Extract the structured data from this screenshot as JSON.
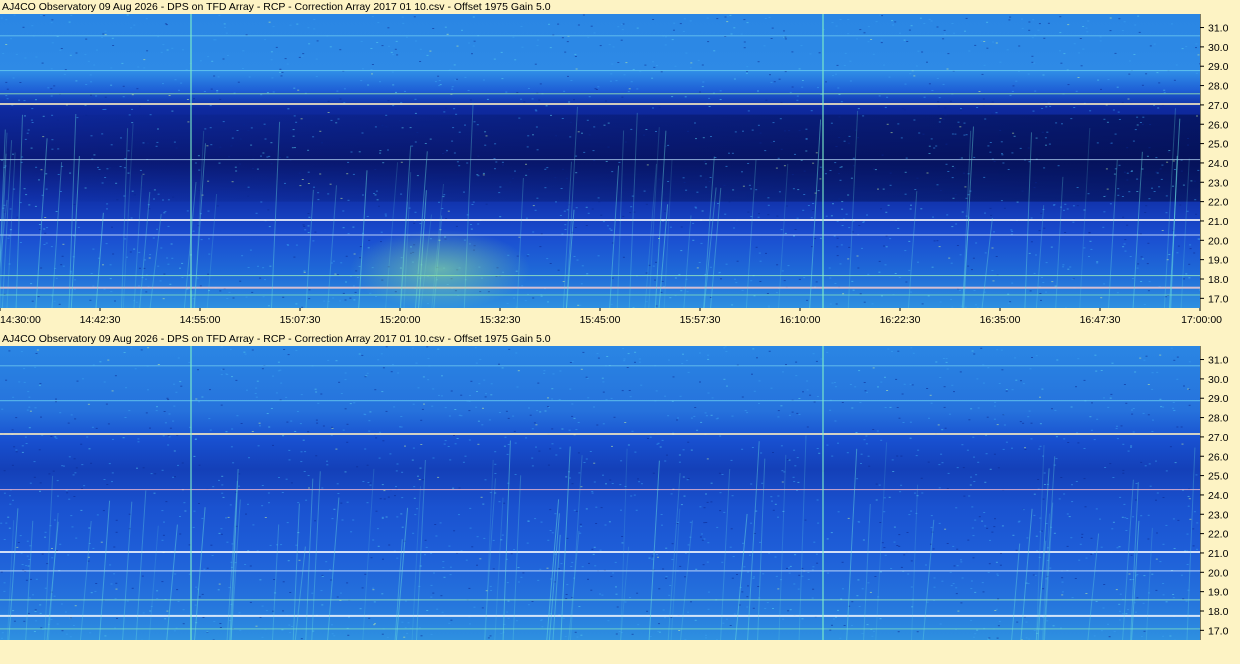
{
  "chart_data": [
    {
      "type": "heatmap",
      "title": "AJ4CO Observatory 09 Aug 2026  -  DPS on TFD Array  -  RCP  -  Correction Array 2017 01 10.csv  -  Offset 1975  Gain 5.0",
      "x_ticks": [
        "14:30:00",
        "14:42:30",
        "14:55:00",
        "15:07:30",
        "15:20:00",
        "15:32:30",
        "15:45:00",
        "15:57:30",
        "16:10:00",
        "16:22:30",
        "16:35:00",
        "16:47:30",
        "17:00:00"
      ],
      "y_ticks": [
        "31.0",
        "30.0",
        "29.0",
        "28.0",
        "27.0",
        "26.0",
        "25.0",
        "24.0",
        "23.0",
        "22.0",
        "21.0",
        "20.0",
        "19.0",
        "18.0",
        "17.0"
      ],
      "xlim": [
        "14:30:00",
        "17:00:00"
      ],
      "ylim": [
        16.5,
        31.7
      ],
      "colors": {
        "background": "#1e56d8",
        "dark": "#0a1870",
        "hot": "#7ff0c8",
        "axis_bg": "#fdf3c4"
      }
    },
    {
      "type": "heatmap",
      "title": "AJ4CO Observatory 09 Aug 2026  -  DPS on TFD Array  -  RCP  -  Correction Array 2017 01 10.csv  -  Offset 1975  Gain 5.0",
      "y_ticks": [
        "31.0",
        "30.0",
        "29.0",
        "28.0",
        "27.0",
        "26.0",
        "25.0",
        "24.0",
        "23.0",
        "22.0",
        "21.0",
        "20.0",
        "19.0",
        "18.0",
        "17.0"
      ],
      "ylim": [
        16.5,
        31.7
      ],
      "colors": {
        "background": "#2164e0",
        "dark": "#0f2da0",
        "hot": "#7ff0c8",
        "axis_bg": "#fdf3c4"
      }
    }
  ]
}
